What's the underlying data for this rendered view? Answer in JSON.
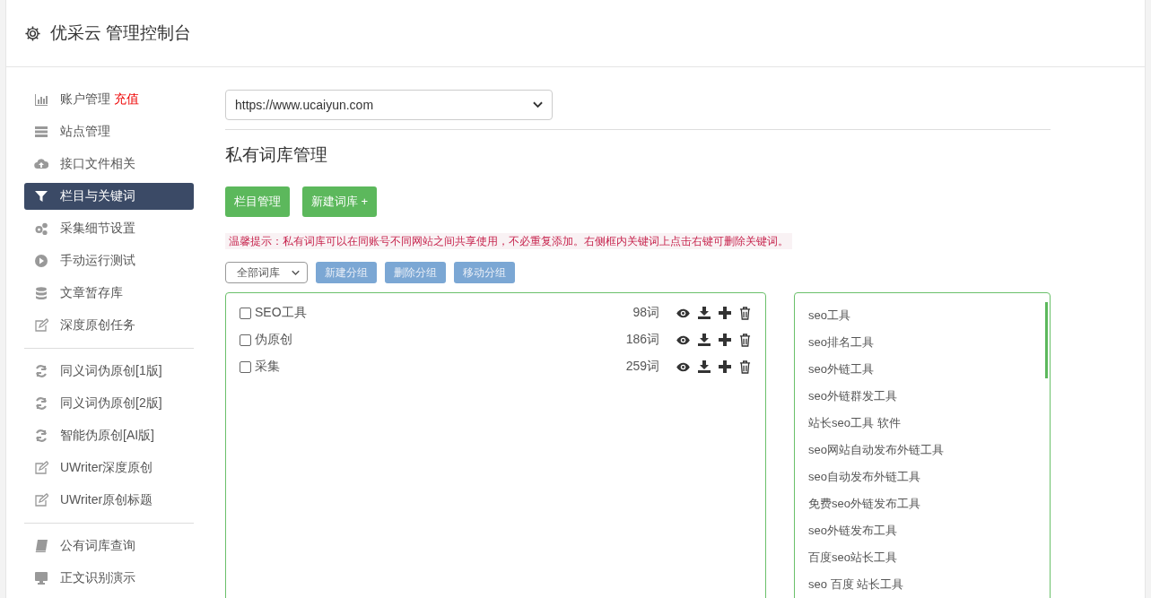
{
  "header": {
    "title": "优采云 管理控制台"
  },
  "sidebar": {
    "groups": [
      {
        "items": [
          {
            "kind": "chart",
            "label": "账户管理",
            "extra": "充值",
            "selected": false
          },
          {
            "kind": "server",
            "label": "站点管理",
            "selected": false
          },
          {
            "kind": "cloud",
            "label": "接口文件相关",
            "selected": false
          },
          {
            "kind": "filter",
            "label": "栏目与关键词",
            "selected": true
          },
          {
            "kind": "gears",
            "label": "采集细节设置",
            "selected": false
          },
          {
            "kind": "play",
            "label": "手动运行测试",
            "selected": false
          },
          {
            "kind": "database",
            "label": "文章暂存库",
            "selected": false
          },
          {
            "kind": "edit",
            "label": "深度原创任务",
            "selected": false
          }
        ]
      },
      {
        "items": [
          {
            "kind": "refresh",
            "label": "同义词伪原创[1版]",
            "selected": false
          },
          {
            "kind": "refresh",
            "label": "同义词伪原创[2版]",
            "selected": false
          },
          {
            "kind": "refresh",
            "label": "智能伪原创[AI版]",
            "selected": false
          },
          {
            "kind": "edit",
            "label": "UWriter深度原创",
            "selected": false
          },
          {
            "kind": "edit",
            "label": "UWriter原创标题",
            "selected": false
          }
        ]
      },
      {
        "items": [
          {
            "kind": "book",
            "label": "公有词库查询",
            "selected": false
          },
          {
            "kind": "monitor",
            "label": "正文识别演示",
            "selected": false
          }
        ]
      }
    ]
  },
  "site_select": {
    "value": "https://www.ucaiyun.com"
  },
  "heading": "私有词库管理",
  "buttons": [
    "栏目管理",
    "新建词库 +"
  ],
  "tip": "温馨提示：私有词库可以在同账号不同网站之间共享使用，不必重复添加。右侧框内关键词上点击右键可删除关键词。",
  "group_select": {
    "value": "全部词库"
  },
  "group_buttons": [
    "新建分组",
    "删除分组",
    "移动分组"
  ],
  "libraries": [
    {
      "name": "SEO工具",
      "count": "98词",
      "checked": false
    },
    {
      "name": "伪原创",
      "count": "186词",
      "checked": false
    },
    {
      "name": "采集",
      "count": "259词",
      "checked": false
    }
  ],
  "keywords": [
    "seo工具",
    "seo排名工具",
    "seo外链工具",
    "seo外链群发工具",
    "站长seo工具 软件",
    "seo网站自动发布外链工具",
    "seo自动发布外链工具",
    "免费seo外链发布工具",
    "seo外链发布工具",
    "百度seo站长工具",
    "seo 百度 站长工具"
  ]
}
